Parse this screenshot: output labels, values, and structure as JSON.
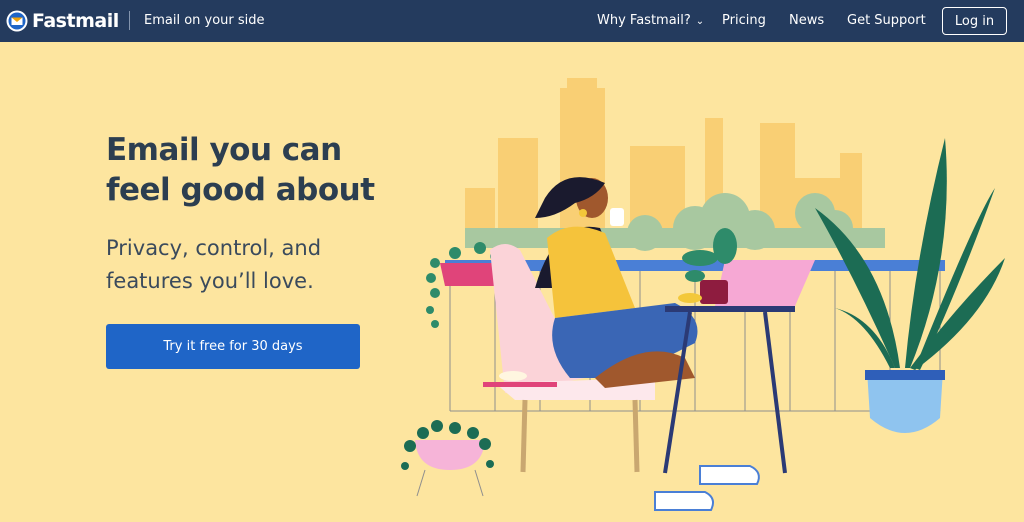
{
  "header": {
    "brand": "Fastmail",
    "tagline": "Email on your side",
    "nav": [
      {
        "label": "Why Fastmail?",
        "has_dropdown": true
      },
      {
        "label": "Pricing"
      },
      {
        "label": "News"
      },
      {
        "label": "Get Support"
      }
    ],
    "login_label": "Log in"
  },
  "hero": {
    "title_line1": "Email you can",
    "title_line2": "feel good about",
    "subtitle_line1": "Privacy, control, and",
    "subtitle_line2": "features you’ll love.",
    "cta_label": "Try it free for 30 days"
  },
  "colors": {
    "nav_bg": "#243b5e",
    "page_bg": "#fde59f",
    "cta_bg": "#1f65c7",
    "heading": "#2c3e50"
  },
  "icons": {
    "logo": "fastmail-envelope-icon",
    "dropdown": "chevron-down-icon"
  }
}
